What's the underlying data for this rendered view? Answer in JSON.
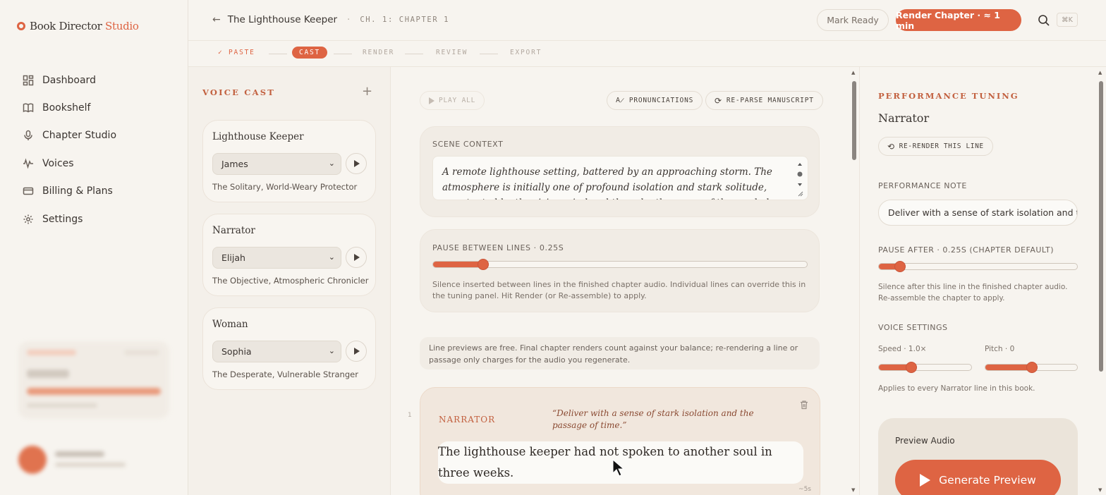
{
  "app": {
    "name_prefix": "Book Director",
    "name_accent": "Studio"
  },
  "sidebar": {
    "items": [
      {
        "label": "Dashboard",
        "icon": "dashboard-icon"
      },
      {
        "label": "Bookshelf",
        "icon": "book-icon"
      },
      {
        "label": "Chapter Studio",
        "icon": "microphone-icon"
      },
      {
        "label": "Voices",
        "icon": "waveform-icon"
      },
      {
        "label": "Billing & Plans",
        "icon": "credit-card-icon"
      },
      {
        "label": "Settings",
        "icon": "gear-icon"
      }
    ]
  },
  "header": {
    "book_title": "The Lighthouse Keeper",
    "chapter": "CH. 1: CHAPTER 1",
    "mark_ready": "Mark Ready",
    "render_chapter": "Render Chapter · ≈ 1 min",
    "shortcut": "⌘K"
  },
  "steps": [
    {
      "label": "✓ PASTE",
      "state": "done"
    },
    {
      "label": "CAST",
      "state": "active"
    },
    {
      "label": "RENDER",
      "state": "pending"
    },
    {
      "label": "REVIEW",
      "state": "pending"
    },
    {
      "label": "EXPORT",
      "state": "pending"
    }
  ],
  "voice_cast": {
    "title": "VOICE CAST",
    "add": "+",
    "cards": [
      {
        "name": "Lighthouse Keeper",
        "voice": "James",
        "description": "The Solitary, World-Weary Protector"
      },
      {
        "name": "Narrator",
        "voice": "Elijah",
        "description": "The Objective, Atmospheric Chronicler"
      },
      {
        "name": "Woman",
        "voice": "Sophia",
        "description": "The Desperate, Vulnerable Stranger"
      }
    ]
  },
  "editor": {
    "play_all": "PLAY ALL",
    "pronunciations": "PRONUNCIATIONS",
    "reparse": "RE-PARSE MANUSCRIPT",
    "scene_context_label": "SCENE CONTEXT",
    "scene_context_text": "A remote lighthouse setting, battered by an approaching storm. The atmosphere is initially one of profound isolation and stark solitude, punctuated by the rising wind and the relentless roar of the sea below.",
    "pause_label": "PAUSE BETWEEN LINES · 0.25S",
    "pause_value": 0.25,
    "pause_help": "Silence inserted between lines in the finished chapter audio. Individual lines can override this in the tuning panel. Hit Render (or Re-assemble) to apply.",
    "notice": "Line previews are free. Final chapter renders count against your balance; re-rendering a line or passage only charges for the audio you regenerate.",
    "line": {
      "number": "1",
      "speaker": "NARRATOR",
      "note": "“Deliver with a sense of stark isolation and the passage of time.”",
      "text": "The lighthouse keeper had not spoken to another soul in three weeks.",
      "duration": "~5s"
    }
  },
  "tuning": {
    "title": "PERFORMANCE TUNING",
    "speaker": "Narrator",
    "rerender": "RE-RENDER THIS LINE",
    "note_label": "PERFORMANCE NOTE",
    "note_value": "Deliver with a sense of stark isolation and the passage of time.",
    "pause_label": "PAUSE AFTER · 0.25S (CHAPTER DEFAULT)",
    "pause_help": "Silence after this line in the finished chapter audio. Re-assemble the chapter to apply.",
    "voice_settings_label": "VOICE SETTINGS",
    "speed_label": "Speed · 1.0×",
    "pitch_label": "Pitch · 0",
    "voice_help": "Applies to every Narrator line in this book.",
    "preview_title": "Preview Audio",
    "generate": "Generate Preview"
  },
  "colors": {
    "accent": "#de6443",
    "accent_text": "#c2603f",
    "background": "#f7f4ef"
  }
}
